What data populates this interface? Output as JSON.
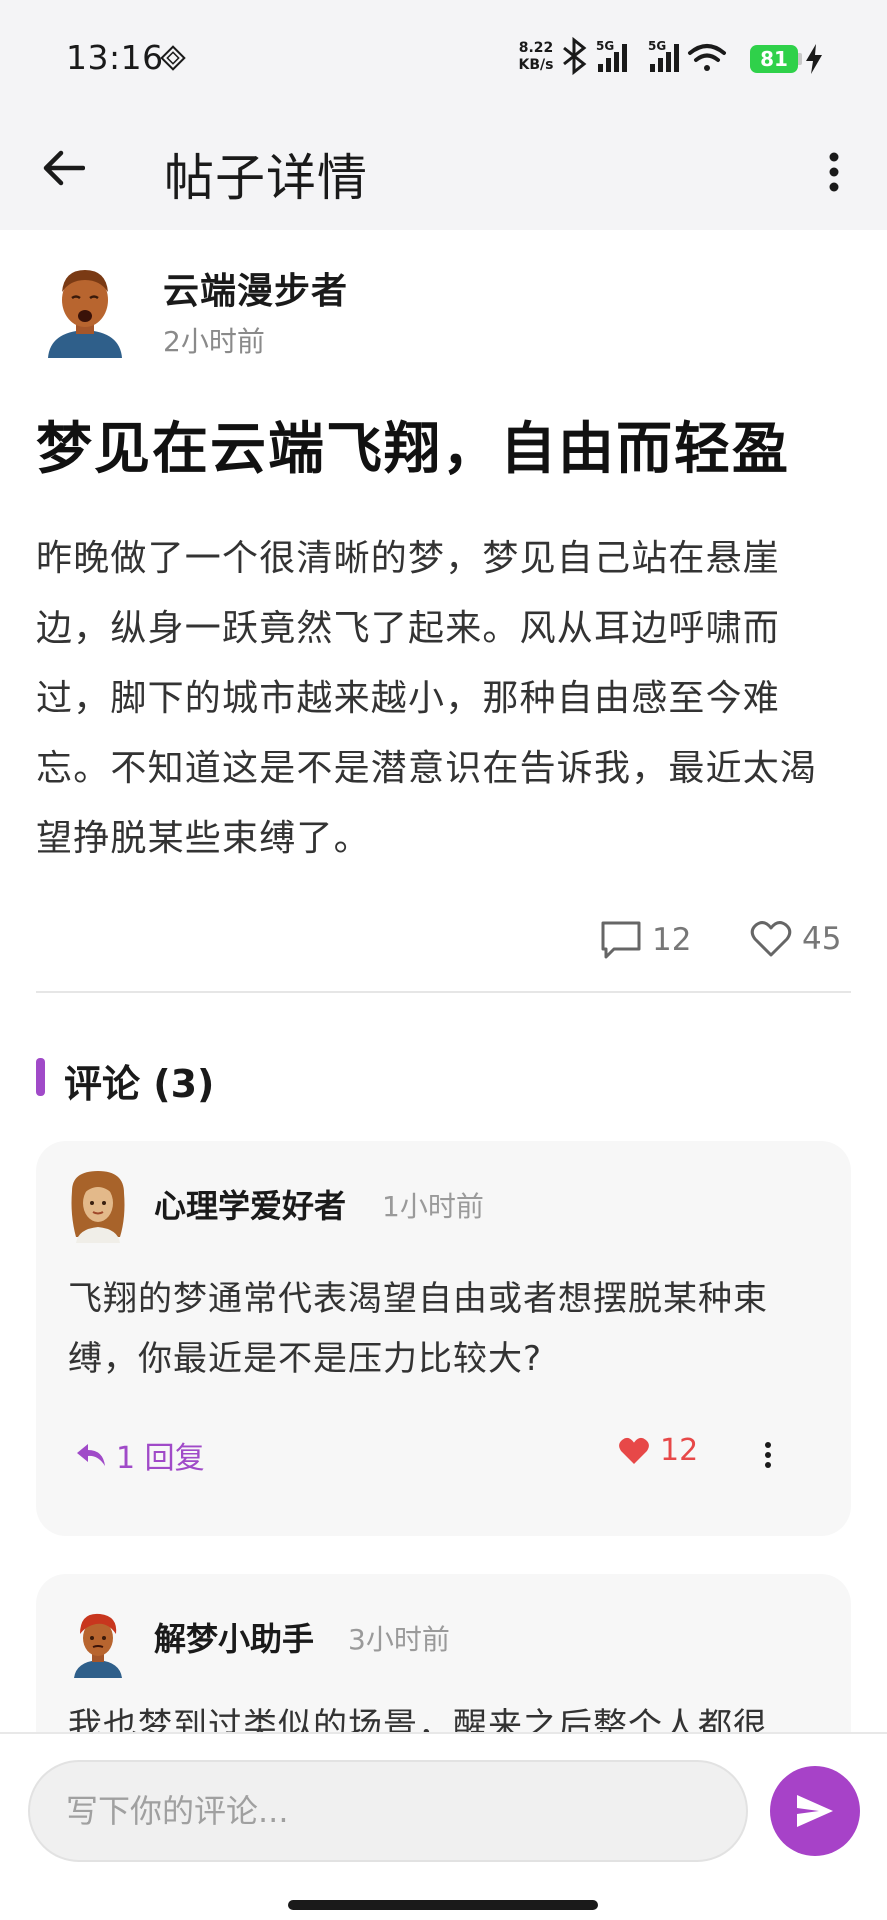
{
  "status_bar": {
    "time": "13:16",
    "net_speed_value": "8.22",
    "net_speed_unit": "KB/s",
    "signal1_label": "5G",
    "signal2_label": "5G",
    "battery": "81"
  },
  "app_bar": {
    "title": "帖子详情"
  },
  "post": {
    "author_name": "云端漫步者",
    "time_ago": "2小时前",
    "title": "梦见在云端飞翔，自由而轻盈",
    "body": "昨晚做了一个很清晰的梦，梦见自己站在悬崖边，纵身一跃竟然飞了起来。风从耳边呼啸而过，脚下的城市越来越小，那种自由感至今难忘。不知道这是不是潜意识在告诉我，最近太渴望挣脱某些束缚了。",
    "comment_count": "12",
    "like_count": "45"
  },
  "comments_section": {
    "title": "评论 (3)"
  },
  "comments": [
    {
      "user": "心理学爱好者",
      "time": "1小时前",
      "text": "飞翔的梦通常代表渴望自由或者想摆脱某种束缚，你最近是不是压力比较大?",
      "reply_label": "1 回复",
      "likes": "12"
    },
    {
      "user": "解梦小助手",
      "time": "3小时前",
      "text": "我也梦到过类似的场景，醒来之后整个人都很"
    }
  ],
  "input": {
    "placeholder": "写下你的评论..."
  },
  "colors": {
    "accent": "#a742c8",
    "like_red": "#e74848",
    "battery_green": "#2fd14a"
  },
  "icons": [
    "back-arrow-icon",
    "more-vertical-icon",
    "comment-icon",
    "heart-outline-icon",
    "heart-filled-icon",
    "reply-icon",
    "send-icon",
    "wifi-icon",
    "bluetooth-icon",
    "signal-icon",
    "charging-icon"
  ]
}
